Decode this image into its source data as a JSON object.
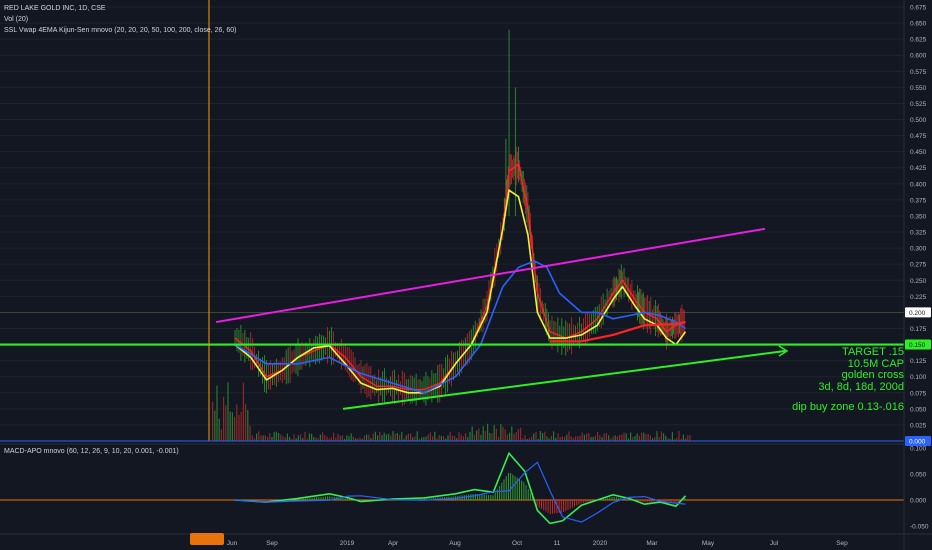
{
  "header": {
    "symbol": "RED LAKE GOLD INC, 1D, CSE",
    "vol": "Vol (20)",
    "indicator": "SSL Vwap 4EMA Kijun-Sen mnovo (20, 20, 20, 50, 100, 200, close, 26, 60)",
    "macd": "MACD-APO mnovo (60, 12, 26, 9, 10, 20, 0.001, -0.001)"
  },
  "annotation": {
    "line1": "TARGET .15",
    "line2": "10.5M CAP",
    "line3": "golden cross",
    "line4": "3d, 8d, 18d, 200d",
    "line5": "dip buy zone 0.13-.016"
  },
  "colors": {
    "background": "#131722",
    "grid": "#1e222d",
    "magenta_trendline": "#e91ee0",
    "green_lines": "#2cf025",
    "yellow_ema": "#f5f23b",
    "red_ma": "#ff2323",
    "blue_ma": "#2962ff",
    "vertical_marker": "#ff9800"
  },
  "chart_data": {
    "type": "line",
    "price_axis": {
      "ylim": [
        0,
        0.68
      ],
      "ticks": [
        "0.675",
        "0.650",
        "0.625",
        "0.600",
        "0.575",
        "0.550",
        "0.525",
        "0.500",
        "0.475",
        "0.450",
        "0.425",
        "0.400",
        "0.375",
        "0.350",
        "0.325",
        "0.300",
        "0.275",
        "0.250",
        "0.225",
        "0.200",
        "0.175",
        "0.150",
        "0.125",
        "0.100",
        "0.075",
        "0.050",
        "0.025",
        "0.000"
      ],
      "badges": [
        "0.200",
        "0.150",
        "0.000"
      ]
    },
    "macd_axis": {
      "ticks": [
        "0.100",
        "0.050",
        "0.000",
        "-0.050"
      ]
    },
    "x_axis": {
      "ticks": [
        "Jun",
        "Sep",
        "2019",
        "Apr",
        "Aug",
        "Oct",
        "11",
        "2020",
        "Mar",
        "May",
        "Jul",
        "Sep"
      ]
    },
    "series": [
      {
        "key": "red",
        "values": [
          [
            0,
            0.16
          ],
          [
            0.5,
            0.14
          ],
          [
            1,
            0.1
          ],
          [
            1.5,
            0.11
          ],
          [
            2,
            0.13
          ],
          [
            2.5,
            0.14
          ],
          [
            3,
            0.15
          ],
          [
            3.5,
            0.13
          ],
          [
            4,
            0.1
          ],
          [
            4.5,
            0.085
          ],
          [
            5,
            0.085
          ],
          [
            5.5,
            0.08
          ],
          [
            6,
            0.08
          ],
          [
            6.5,
            0.09
          ],
          [
            7,
            0.12
          ],
          [
            7.5,
            0.15
          ],
          [
            8,
            0.21
          ],
          [
            8.5,
            0.33
          ],
          [
            8.7,
            0.42
          ],
          [
            9,
            0.43
          ],
          [
            9.3,
            0.36
          ],
          [
            9.6,
            0.23
          ],
          [
            10,
            0.17
          ],
          [
            10.5,
            0.16
          ],
          [
            11,
            0.17
          ],
          [
            11.5,
            0.19
          ],
          [
            12,
            0.23
          ],
          [
            12.3,
            0.25
          ],
          [
            12.7,
            0.22
          ],
          [
            13,
            0.2
          ],
          [
            13.4,
            0.19
          ],
          [
            13.7,
            0.17
          ],
          [
            14,
            0.18
          ],
          [
            14.3,
            0.185
          ]
        ]
      },
      {
        "key": "yellow",
        "values": [
          [
            0,
            0.15
          ],
          [
            0.5,
            0.13
          ],
          [
            1,
            0.095
          ],
          [
            1.5,
            0.11
          ],
          [
            2,
            0.13
          ],
          [
            2.5,
            0.145
          ],
          [
            3,
            0.148
          ],
          [
            3.5,
            0.12
          ],
          [
            4,
            0.09
          ],
          [
            4.5,
            0.08
          ],
          [
            5,
            0.082
          ],
          [
            5.5,
            0.075
          ],
          [
            6,
            0.075
          ],
          [
            6.5,
            0.085
          ],
          [
            7,
            0.12
          ],
          [
            7.5,
            0.15
          ],
          [
            8,
            0.2
          ],
          [
            8.5,
            0.33
          ],
          [
            8.7,
            0.39
          ],
          [
            9,
            0.38
          ],
          [
            9.3,
            0.32
          ],
          [
            9.6,
            0.2
          ],
          [
            10,
            0.16
          ],
          [
            10.5,
            0.16
          ],
          [
            11,
            0.165
          ],
          [
            11.5,
            0.18
          ],
          [
            12,
            0.22
          ],
          [
            12.3,
            0.24
          ],
          [
            12.7,
            0.21
          ],
          [
            13,
            0.19
          ],
          [
            13.4,
            0.18
          ],
          [
            13.7,
            0.16
          ],
          [
            14,
            0.15
          ],
          [
            14.3,
            0.17
          ]
        ]
      },
      {
        "key": "blue",
        "values": [
          [
            0,
            0.15
          ],
          [
            1,
            0.12
          ],
          [
            2,
            0.12
          ],
          [
            3,
            0.13
          ],
          [
            4,
            0.105
          ],
          [
            5,
            0.09
          ],
          [
            6,
            0.075
          ],
          [
            7,
            0.1
          ],
          [
            7.8,
            0.15
          ],
          [
            8.5,
            0.24
          ],
          [
            9,
            0.27
          ],
          [
            9.5,
            0.28
          ],
          [
            9.9,
            0.27
          ],
          [
            10.3,
            0.23
          ],
          [
            11,
            0.2
          ],
          [
            11.5,
            0.2
          ],
          [
            12,
            0.19
          ],
          [
            12.5,
            0.195
          ],
          [
            13,
            0.2
          ],
          [
            13.5,
            0.195
          ],
          [
            14,
            0.185
          ],
          [
            14.3,
            0.175
          ]
        ]
      },
      {
        "key": "redma",
        "values": [
          [
            10,
            0.155
          ],
          [
            11,
            0.155
          ],
          [
            12,
            0.165
          ],
          [
            13,
            0.18
          ],
          [
            14,
            0.182
          ],
          [
            14.3,
            0.185
          ]
        ]
      }
    ],
    "trendlines": [
      {
        "name": "magenta-resistance",
        "from": [
          0,
          0.185
        ],
        "to": [
          16.5,
          0.33
        ]
      },
      {
        "name": "green-support",
        "from": [
          3.5,
          0.05
        ],
        "to": [
          16.5,
          0.14
        ]
      },
      {
        "name": "green-target",
        "value": 0.15
      }
    ]
  }
}
